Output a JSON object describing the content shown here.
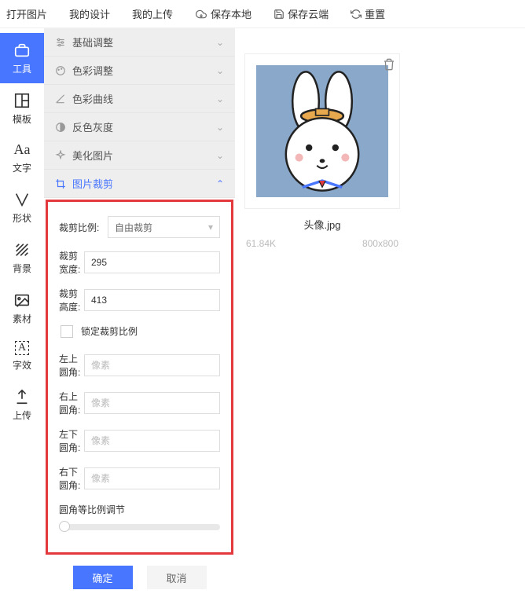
{
  "top_menu": {
    "open_image": "打开图片",
    "my_design": "我的设计",
    "my_upload": "我的上传",
    "save_local": "保存本地",
    "save_cloud": "保存云端",
    "reset": "重置"
  },
  "sidebar": {
    "tools": "工具",
    "template": "模板",
    "text": "文字",
    "shape": "形状",
    "background": "背景",
    "material": "素材",
    "text_effect": "字效",
    "upload": "上传"
  },
  "accordion": {
    "basic": "基础调整",
    "color": "色彩调整",
    "curve": "色彩曲线",
    "invert": "反色灰度",
    "beautify": "美化图片",
    "crop": "图片裁剪"
  },
  "crop_form": {
    "ratio_label": "裁剪比例:",
    "ratio_value": "自由裁剪",
    "width_label": "裁剪宽度:",
    "width_value": "295",
    "height_label": "裁剪高度:",
    "height_value": "413",
    "lock_ratio": "锁定裁剪比例",
    "tl_label": "左上圆角:",
    "tr_label": "右上圆角:",
    "bl_label": "左下圆角:",
    "br_label": "右下圆角:",
    "pixel_placeholder": "像素",
    "slider_label": "圆角等比例调节"
  },
  "buttons": {
    "confirm": "确定",
    "cancel": "取消"
  },
  "image": {
    "name": "头像.jpg",
    "size": "61.84K",
    "dimensions": "800x800"
  }
}
